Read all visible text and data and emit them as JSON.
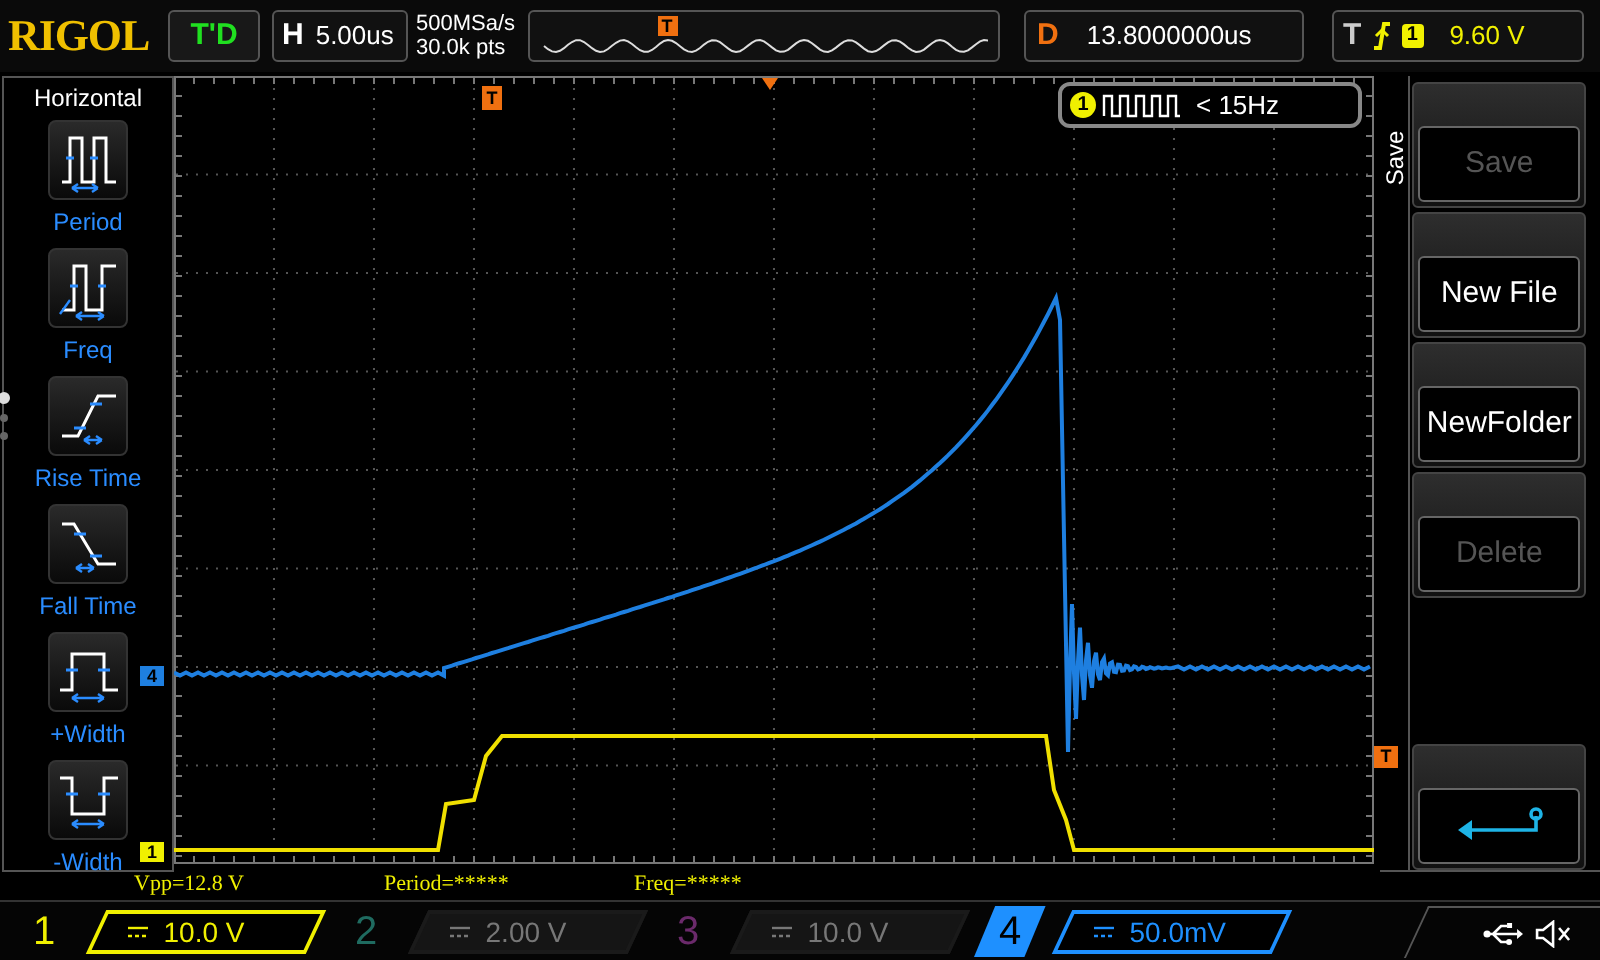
{
  "header": {
    "logo": "RIGOL",
    "run_state": "T'D",
    "horizontal_label": "H",
    "timebase": "5.00us",
    "sample_rate": "500MSa/s",
    "memory_depth": "30.0k pts",
    "trigger_position_marker": "T",
    "delay_label": "D",
    "delay": "13.8000000us",
    "trigger_label": "T",
    "trigger_source": "1",
    "trigger_level": "9.60 V"
  },
  "left_menu": {
    "title": "Horizontal",
    "items": [
      {
        "label": "Period",
        "kind": "period"
      },
      {
        "label": "Freq",
        "kind": "freq"
      },
      {
        "label": "Rise Time",
        "kind": "rise"
      },
      {
        "label": "Fall Time",
        "kind": "fall"
      },
      {
        "label": "+Width",
        "kind": "pwidth"
      },
      {
        "label": "-Width",
        "kind": "nwidth"
      }
    ],
    "page_dots": [
      {
        "selected": true
      },
      {
        "selected": false
      },
      {
        "selected": false
      }
    ]
  },
  "plot": {
    "trigger_marker": "T",
    "channel_markers": [
      {
        "label": "4",
        "color": "#1e7fe0"
      },
      {
        "label": "1",
        "color": "#f0f000"
      }
    ],
    "trigger_level_marker": "T",
    "frequency_counter": {
      "channel": "1",
      "reading": "< 15Hz"
    }
  },
  "measurements": [
    "Vpp=12.8 V",
    "Period=*****",
    "Freq=*****"
  ],
  "right_menu": {
    "title": "Save",
    "buttons": [
      {
        "kind": "text",
        "label": "Save",
        "disabled": true
      },
      {
        "kind": "text",
        "label": "New File",
        "disabled": false
      },
      {
        "kind": "text",
        "label": "NewFolder",
        "disabled": false
      },
      {
        "kind": "text",
        "label": "Delete",
        "disabled": true
      },
      {
        "kind": "back"
      }
    ]
  },
  "channels": [
    {
      "number": "1",
      "scale": "10.0 V",
      "color": "#f0f000",
      "on": true,
      "selected": false
    },
    {
      "number": "2",
      "scale": "2.00 V",
      "color": "#1f6b60",
      "on": false,
      "selected": false
    },
    {
      "number": "3",
      "scale": "10.0 V",
      "color": "#6b2a6b",
      "on": false,
      "selected": false
    },
    {
      "number": "4",
      "scale": "50.0mV",
      "color": "#1e90ff",
      "on": true,
      "selected": true
    }
  ]
}
